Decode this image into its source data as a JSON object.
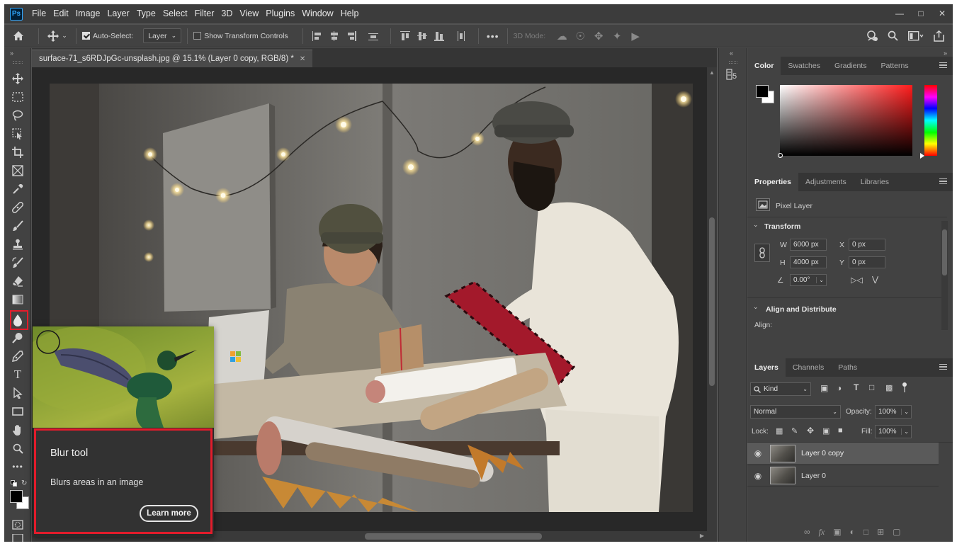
{
  "menubar": {
    "logo": "Ps",
    "items": [
      "File",
      "Edit",
      "Image",
      "Layer",
      "Type",
      "Select",
      "Filter",
      "3D",
      "View",
      "Plugins",
      "Window",
      "Help"
    ]
  },
  "options": {
    "auto_select_label": "Auto-Select:",
    "auto_select_value": "Layer",
    "show_transform_label": "Show Transform Controls",
    "mode_3d_label": "3D Mode:"
  },
  "document": {
    "tab_title": "surface-71_s6RDJpGc-unsplash.jpg @ 15.1% (Layer 0 copy, RGB/8) *"
  },
  "tooltip": {
    "title": "Blur tool",
    "description": "Blurs areas in an image",
    "learn_more": "Learn more"
  },
  "color_panel": {
    "tabs": [
      "Color",
      "Swatches",
      "Gradients",
      "Patterns"
    ],
    "foreground": "#000000",
    "background": "#ffffff",
    "hue_color": "#ff1c1c"
  },
  "properties_panel": {
    "tabs": [
      "Properties",
      "Adjustments",
      "Libraries"
    ],
    "pixel_layer_label": "Pixel Layer",
    "transform_header": "Transform",
    "w_label": "W",
    "w_value": "6000 px",
    "h_label": "H",
    "h_value": "4000 px",
    "x_label": "X",
    "x_value": "0 px",
    "y_label": "Y",
    "y_value": "0 px",
    "angle_value": "0.00°",
    "align_header": "Align and Distribute",
    "align_label": "Align:"
  },
  "layers_panel": {
    "tabs": [
      "Layers",
      "Channels",
      "Paths"
    ],
    "kind_label": "Kind",
    "blend_mode": "Normal",
    "opacity_label": "Opacity:",
    "opacity_value": "100%",
    "lock_label": "Lock:",
    "fill_label": "Fill:",
    "fill_value": "100%",
    "layers": [
      {
        "name": "Layer 0 copy",
        "selected": true
      },
      {
        "name": "Layer 0",
        "selected": false
      }
    ]
  },
  "accent": "#e31c2b"
}
